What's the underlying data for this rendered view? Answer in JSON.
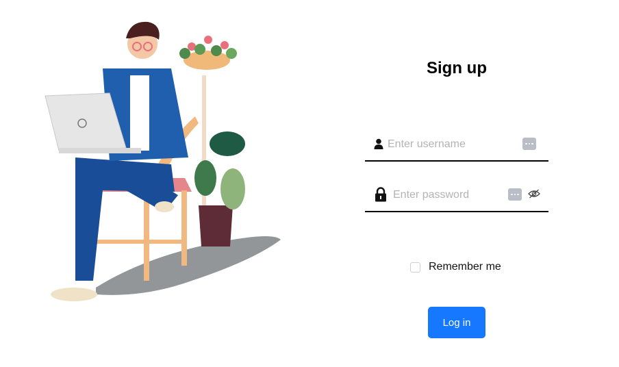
{
  "form": {
    "title": "Sign up",
    "username": {
      "placeholder": "Enter username",
      "value": "",
      "icon": "user-icon"
    },
    "password": {
      "placeholder": "Enter password",
      "value": "",
      "icon": "lock-icon",
      "toggle_icon": "eye-slash-icon"
    },
    "remember": {
      "label": "Remember me",
      "checked": false
    },
    "submit_label": "Log in"
  },
  "colors": {
    "accent": "#1677ff",
    "underline": "#000000",
    "placeholder": "#b3b3b3",
    "password_manager_key": "#b9bec6"
  }
}
